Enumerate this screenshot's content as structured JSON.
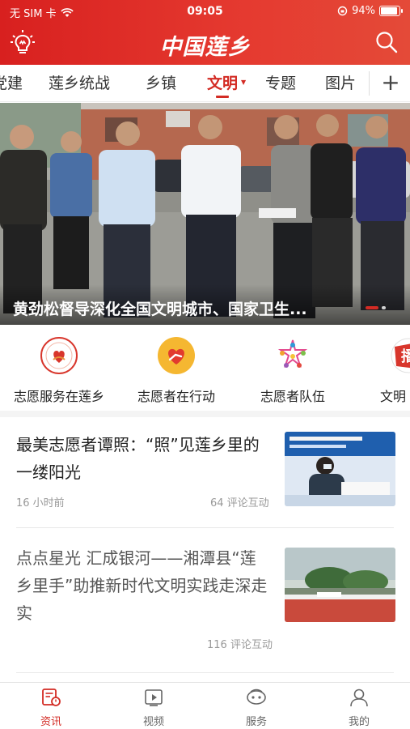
{
  "status_bar": {
    "carrier": "无 SIM 卡",
    "time": "09:05",
    "battery": "94%",
    "battery_level": 0.94
  },
  "header": {
    "app_title": "中国莲乡",
    "icons": [
      "lightbulb-icon",
      "search-icon"
    ]
  },
  "tabs": {
    "items": [
      {
        "label": "党建"
      },
      {
        "label": "莲乡统战"
      },
      {
        "label": "乡镇"
      },
      {
        "label": "文明",
        "active": true
      },
      {
        "label": "专题"
      },
      {
        "label": "图片"
      }
    ],
    "add_label": "+"
  },
  "hero": {
    "title": "黄劲松督导深化全国文明城市、国家卫生..."
  },
  "channels": [
    {
      "label": "志愿服务在莲乡",
      "icon": "volunteer-service-logo-icon"
    },
    {
      "label": "志愿者在行动",
      "icon": "heart-hand-icon"
    },
    {
      "label": "志愿者队伍",
      "icon": "team-star-icon"
    },
    {
      "label": "文明",
      "icon": "broadcast-icon"
    }
  ],
  "news": [
    {
      "title": "最美志愿者谭照：“照”见莲乡里的一缕阳光",
      "time": "16 小时前",
      "comments": "64 评论互动"
    },
    {
      "title": "点点星光 汇成银河——湘潭县“莲乡里手”助推新时代文明实践走深走实",
      "time": "",
      "comments": "116 评论互动"
    }
  ],
  "bottom_nav": [
    {
      "label": "资讯",
      "icon": "news-icon",
      "active": true
    },
    {
      "label": "视频",
      "icon": "video-icon"
    },
    {
      "label": "服务",
      "icon": "service-icon"
    },
    {
      "label": "我的",
      "icon": "profile-icon"
    }
  ],
  "colors": {
    "brand_red": "#d32b24",
    "header_red": "#e03a2f",
    "text": "#222222",
    "muted": "#999999"
  }
}
